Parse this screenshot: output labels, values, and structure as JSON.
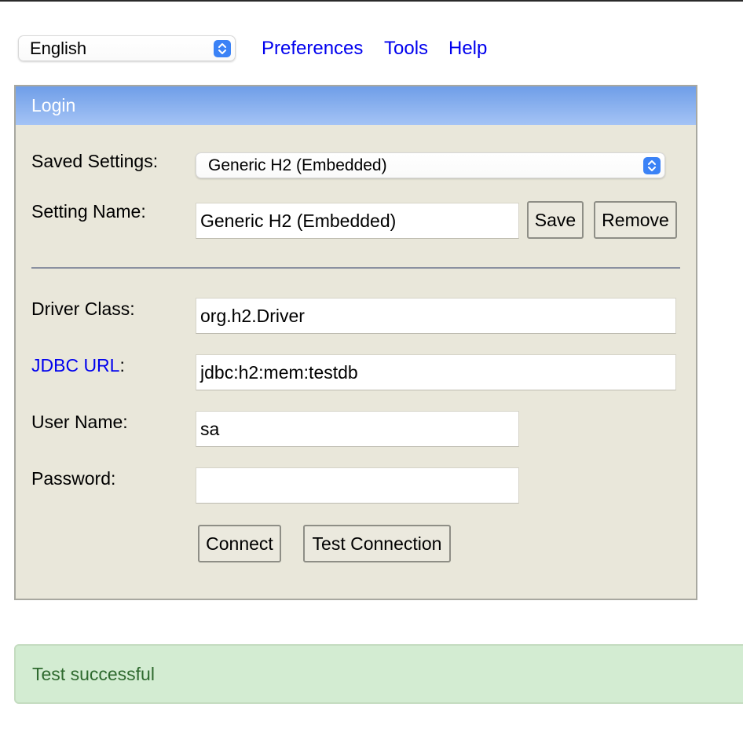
{
  "top_bar": {
    "language": "English",
    "links": [
      "Preferences",
      "Tools",
      "Help"
    ]
  },
  "login": {
    "title": "Login",
    "saved_settings": {
      "label": "Saved Settings:",
      "value": "Generic H2 (Embedded)"
    },
    "setting_name": {
      "label": "Setting Name:",
      "value": "Generic H2 (Embedded)",
      "save_label": "Save",
      "remove_label": "Remove"
    },
    "driver_class": {
      "label": "Driver Class:",
      "value": "org.h2.Driver"
    },
    "jdbc_url": {
      "label_link": "JDBC URL",
      "label_suffix": ":",
      "value": "jdbc:h2:mem:testdb"
    },
    "user_name": {
      "label": "User Name:",
      "value": "sa"
    },
    "password": {
      "label": "Password:",
      "value": ""
    },
    "connect_label": "Connect",
    "test_connection_label": "Test Connection"
  },
  "status": {
    "message": "Test successful"
  },
  "colors": {
    "panel_bg": "#e9e7da",
    "header_gradient_top": "#6f9ee8",
    "header_gradient_bottom": "#a4c3f5",
    "link": "#0000ee",
    "success_bg": "#d3ecd2",
    "success_text": "#2f6a2f"
  },
  "icons": {
    "select_stepper": "chevron-updown-icon"
  }
}
